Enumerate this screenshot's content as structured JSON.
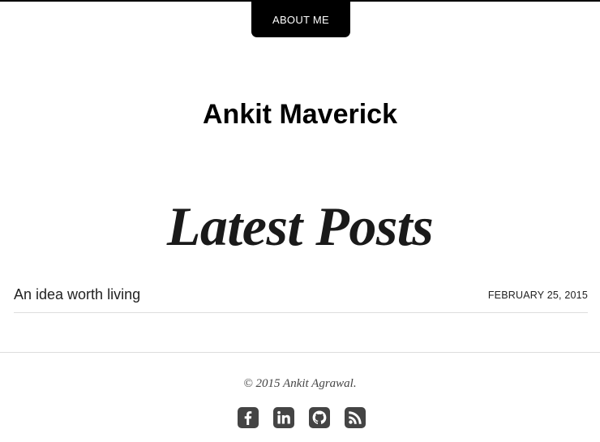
{
  "nav": {
    "about_label": "ABOUT ME"
  },
  "site": {
    "title": "Ankit Maverick"
  },
  "main": {
    "section_title": "Latest Posts",
    "posts": [
      {
        "title": "An idea worth living",
        "date": "FEBRUARY 25, 2015"
      }
    ]
  },
  "footer": {
    "copyright": "© 2015 Ankit Agrawal.",
    "social": [
      {
        "icon": "facebook-icon"
      },
      {
        "icon": "linkedin-icon"
      },
      {
        "icon": "github-icon"
      },
      {
        "icon": "rss-icon"
      }
    ],
    "icon_color": "#444444"
  }
}
